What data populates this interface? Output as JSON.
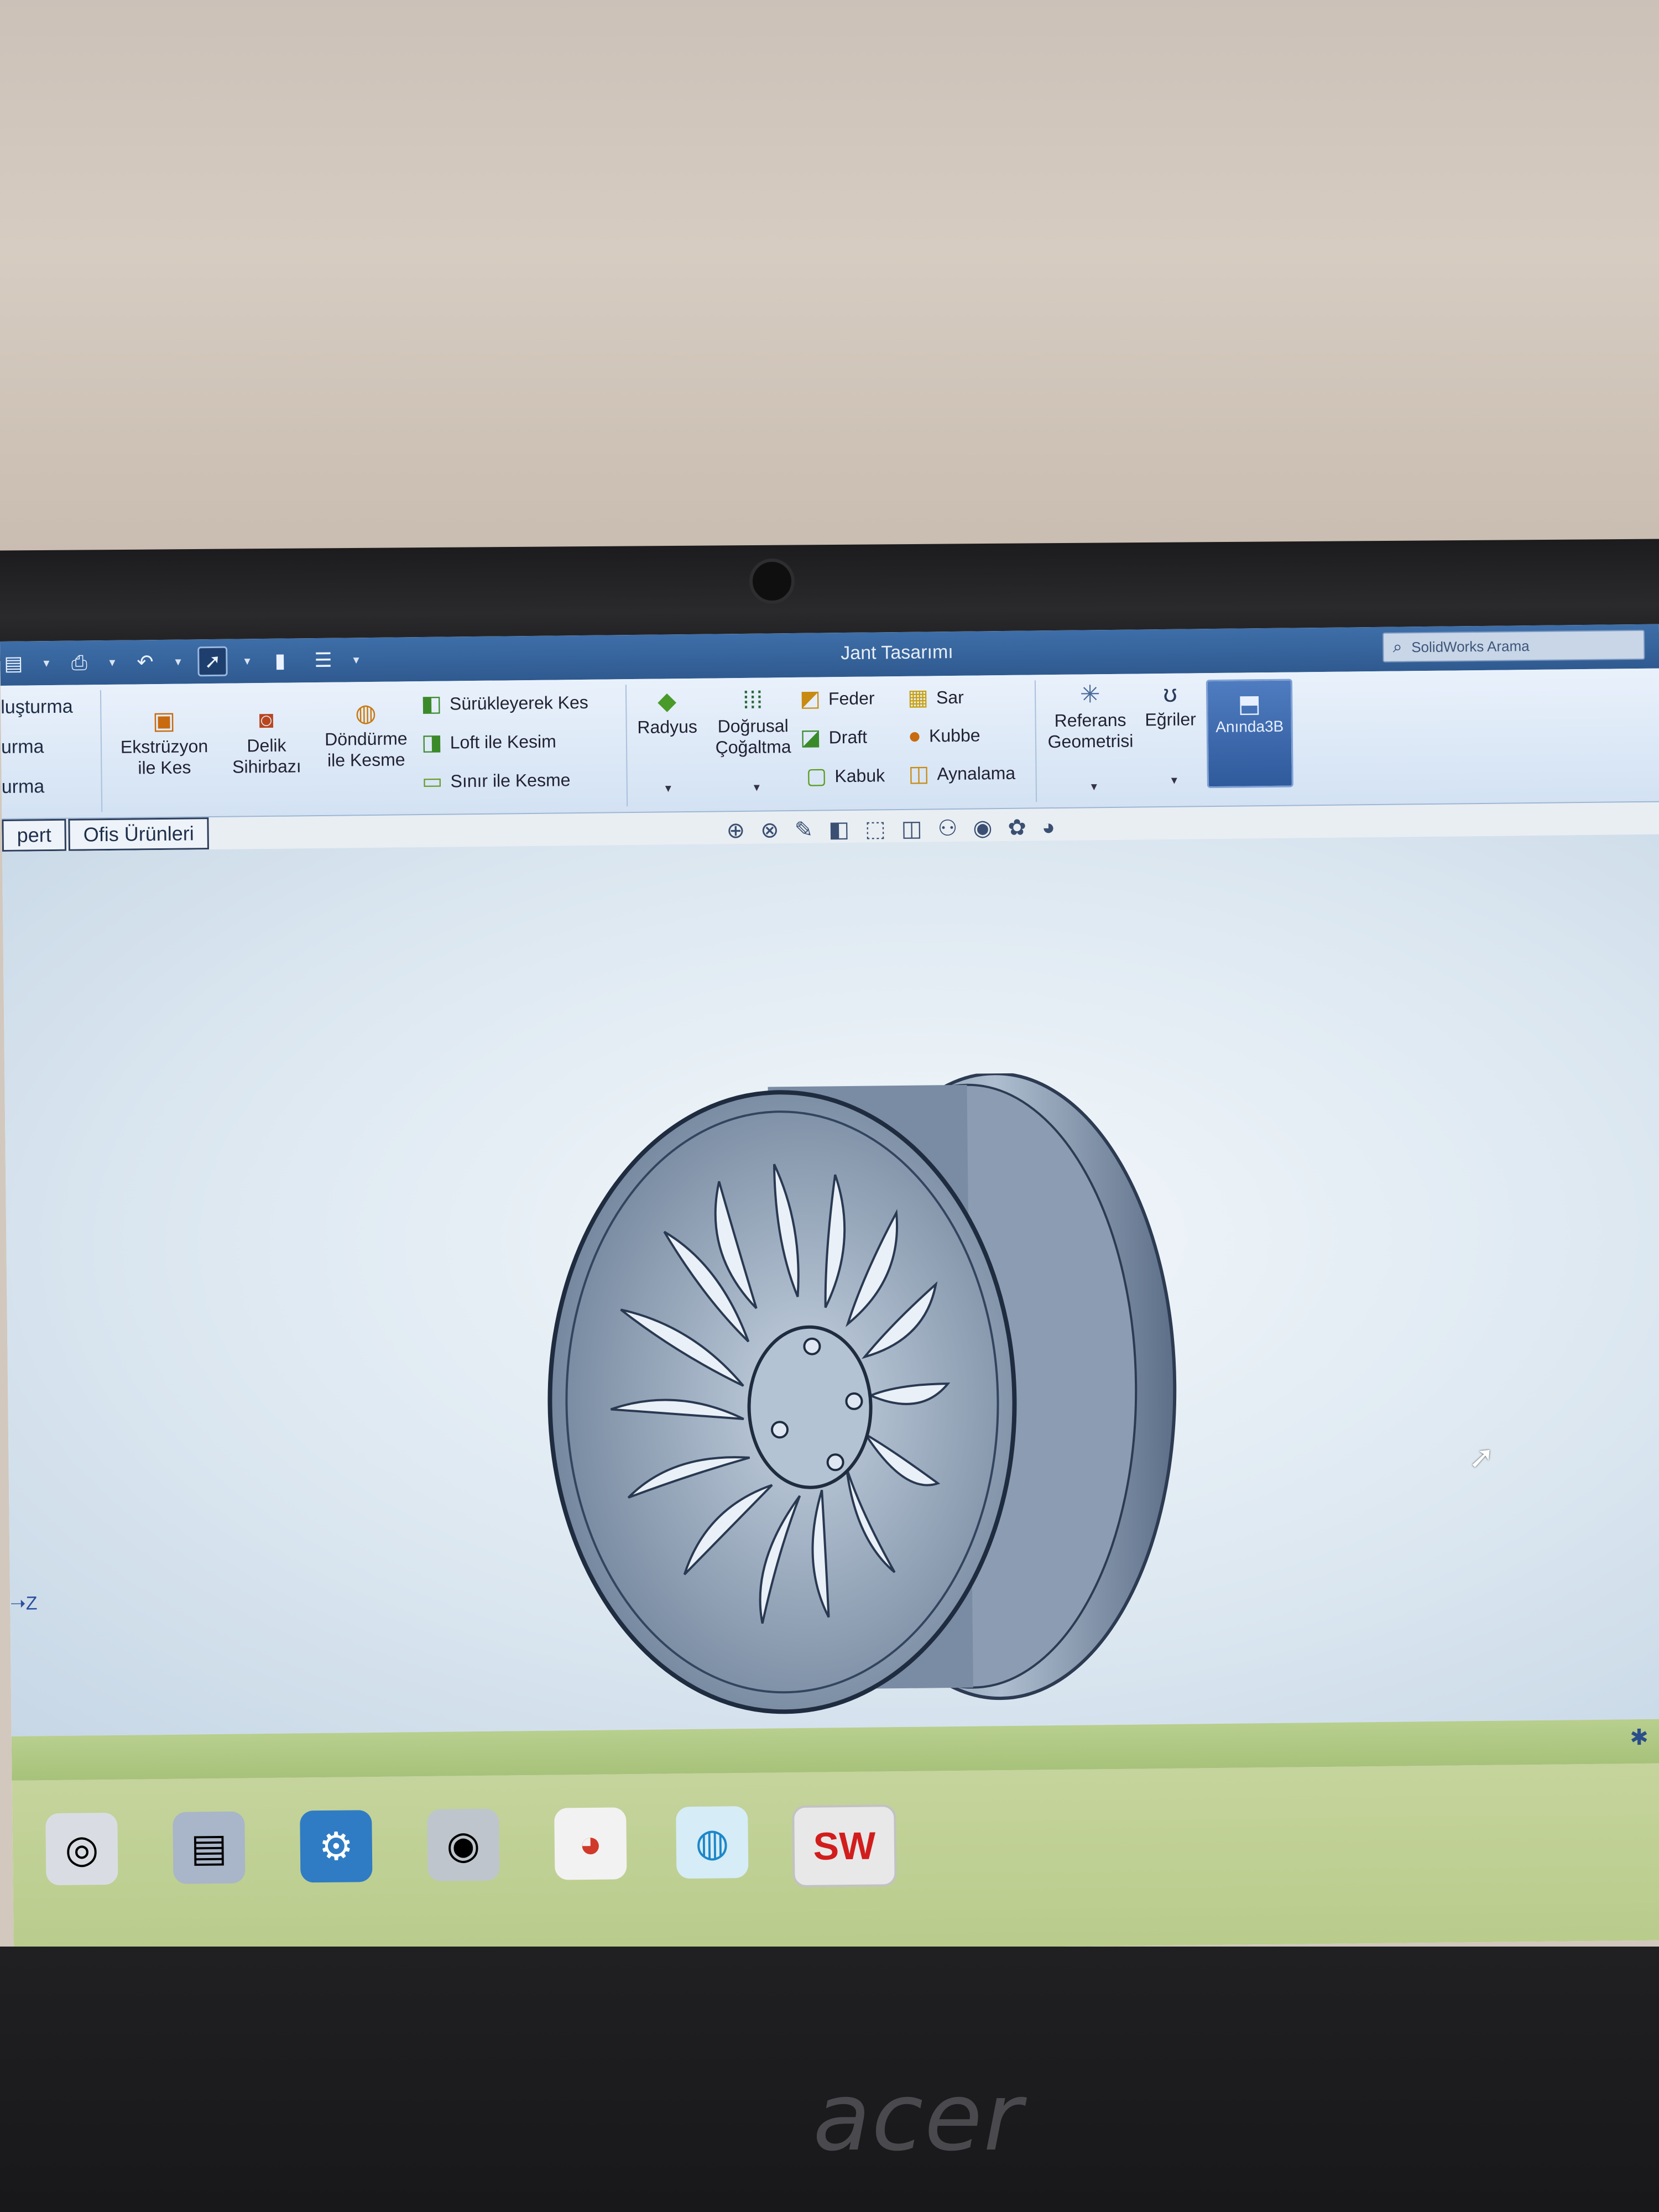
{
  "window": {
    "title": "Jant Tasarımı",
    "search_placeholder": "SolidWorks Arama"
  },
  "ribbon": {
    "left_labels": [
      "luşturma",
      "urma",
      "urma"
    ],
    "groups": {
      "extrude_cut": "Ekstrüzyon\nile Kes",
      "hole_wizard": "Delik\nSihirbazı",
      "revolve_cut": "Döndürme\nile Kesme",
      "sweep_cut": "Sürükleyerek Kes",
      "loft_cut": "Loft ile Kesim",
      "boundary_cut": "Sınır ile Kesme",
      "fillet": "Radyus",
      "linear_pattern": "Doğrusal\nÇoğaltma",
      "rib": "Feder",
      "draft": "Draft",
      "shell": "Kabuk",
      "wrap": "Sar",
      "dome": "Kubbe",
      "mirror": "Aynalama",
      "ref_geometry": "Referans\nGeometrisi",
      "curves": "Eğriler",
      "instant3d": "Anında3B"
    }
  },
  "tabs": [
    "pert",
    "Ofis Ürünleri"
  ],
  "viewport": {
    "model": "wheel-rim",
    "axis_label": "Z"
  },
  "taskbar": {
    "apps": [
      "disk-icon",
      "doc-icon",
      "settings-icon",
      "speaker-icon",
      "chrome-icon",
      "edge-icon",
      "solidworks-icon"
    ],
    "sw_label": "SW"
  },
  "device": {
    "brand": "acer"
  },
  "colors": {
    "titlebar": "#2f5a90",
    "ribbon": "#d3e2f3",
    "instant3d": "#2f5a9c",
    "taskbar": "#b9cc8c"
  }
}
